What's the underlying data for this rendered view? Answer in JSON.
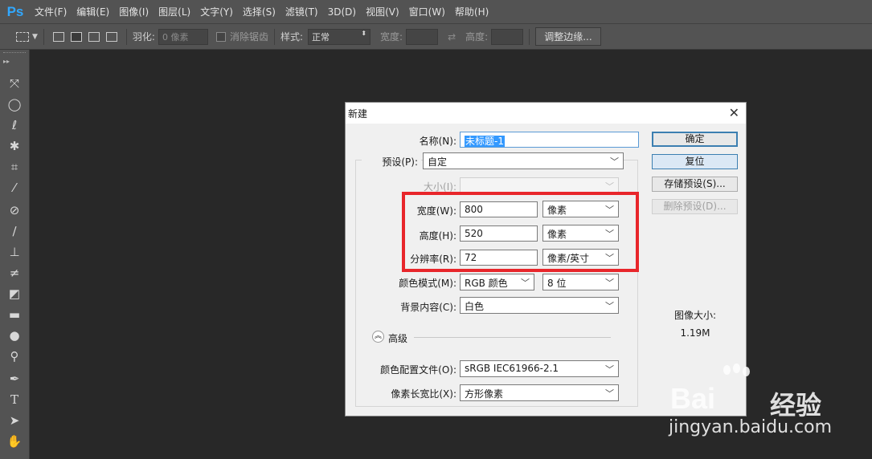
{
  "app": {
    "logo": "Ps"
  },
  "menu": [
    "文件(F)",
    "编辑(E)",
    "图像(I)",
    "图层(L)",
    "文字(Y)",
    "选择(S)",
    "滤镜(T)",
    "3D(D)",
    "视图(V)",
    "窗口(W)",
    "帮助(H)"
  ],
  "options": {
    "feather_label": "羽化:",
    "feather_value": "0 像素",
    "antialias_label": "消除锯齿",
    "style_label": "样式:",
    "style_value": "正常",
    "width_label": "宽度:",
    "height_label": "高度:",
    "refine_button": "调整边缘..."
  },
  "dialog": {
    "title": "新建",
    "name_label": "名称(N):",
    "name_value": "未标题-1",
    "preset_label": "预设(P):",
    "preset_value": "自定",
    "size_label": "大小(I):",
    "width_label": "宽度(W):",
    "width_value": "800",
    "width_unit": "像素",
    "height_label": "高度(H):",
    "height_value": "520",
    "height_unit": "像素",
    "resolution_label": "分辨率(R):",
    "resolution_value": "72",
    "resolution_unit": "像素/英寸",
    "color_mode_label": "颜色模式(M):",
    "color_mode_value": "RGB 颜色",
    "bit_depth_value": "8 位",
    "background_label": "背景内容(C):",
    "background_value": "白色",
    "advanced_label": "高级",
    "color_profile_label": "颜色配置文件(O):",
    "color_profile_value": "sRGB IEC61966-2.1",
    "pixel_aspect_label": "像素长宽比(X):",
    "pixel_aspect_value": "方形像素",
    "ok_button": "确定",
    "reset_button": "复位",
    "save_preset_button": "存储预设(S)...",
    "delete_preset_button": "删除预设(D)...",
    "image_size_label": "图像大小:",
    "image_size_value": "1.19M"
  },
  "watermark": {
    "brand": "Bai",
    "brand2": "经验",
    "url": "jingyan.baidu.com"
  }
}
